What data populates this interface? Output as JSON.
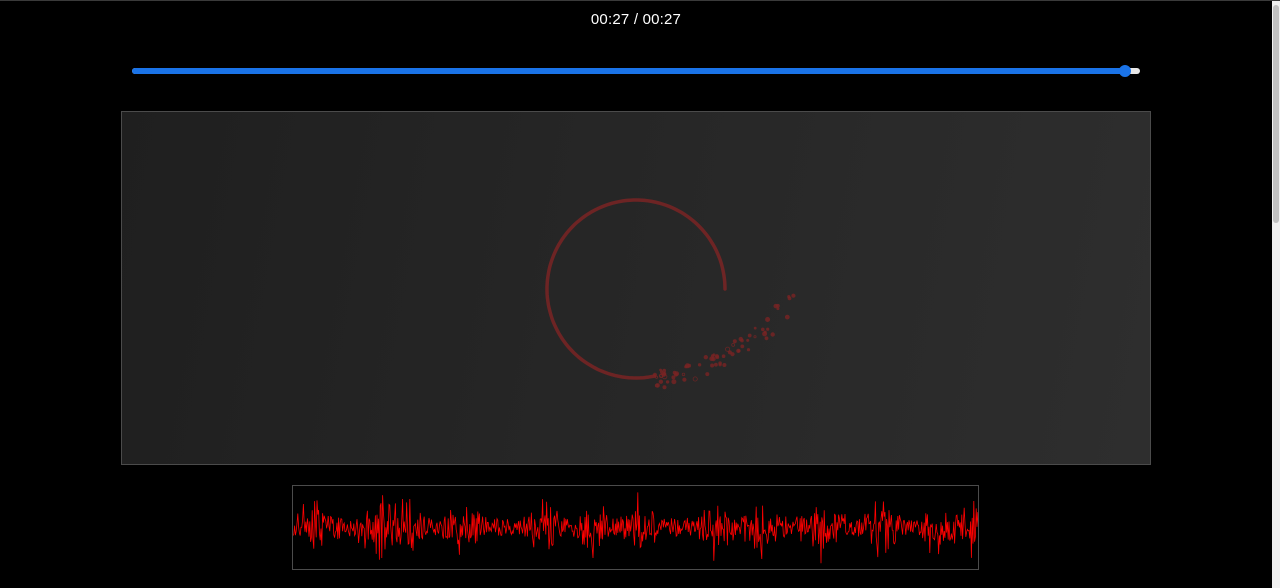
{
  "player": {
    "current_time": "00:27",
    "separator": "/",
    "duration": "00:27",
    "progress": 0.985
  },
  "colors": {
    "accent": "#1a73e8",
    "track": "#e8e8e8",
    "visualizer_stroke": "#7a2424",
    "waveform": "#ff0000",
    "background": "#000000"
  }
}
